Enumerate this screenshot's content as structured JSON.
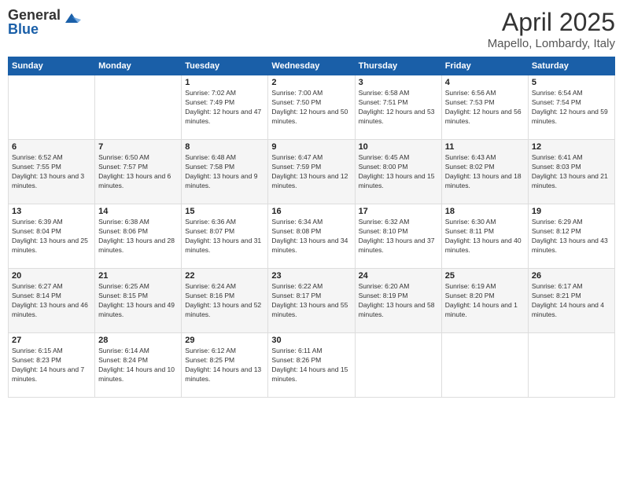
{
  "logo": {
    "general": "General",
    "blue": "Blue"
  },
  "header": {
    "month": "April 2025",
    "location": "Mapello, Lombardy, Italy"
  },
  "weekdays": [
    "Sunday",
    "Monday",
    "Tuesday",
    "Wednesday",
    "Thursday",
    "Friday",
    "Saturday"
  ],
  "weeks": [
    [
      {
        "day": "",
        "info": ""
      },
      {
        "day": "",
        "info": ""
      },
      {
        "day": "1",
        "info": "Sunrise: 7:02 AM\nSunset: 7:49 PM\nDaylight: 12 hours and 47 minutes."
      },
      {
        "day": "2",
        "info": "Sunrise: 7:00 AM\nSunset: 7:50 PM\nDaylight: 12 hours and 50 minutes."
      },
      {
        "day": "3",
        "info": "Sunrise: 6:58 AM\nSunset: 7:51 PM\nDaylight: 12 hours and 53 minutes."
      },
      {
        "day": "4",
        "info": "Sunrise: 6:56 AM\nSunset: 7:53 PM\nDaylight: 12 hours and 56 minutes."
      },
      {
        "day": "5",
        "info": "Sunrise: 6:54 AM\nSunset: 7:54 PM\nDaylight: 12 hours and 59 minutes."
      }
    ],
    [
      {
        "day": "6",
        "info": "Sunrise: 6:52 AM\nSunset: 7:55 PM\nDaylight: 13 hours and 3 minutes."
      },
      {
        "day": "7",
        "info": "Sunrise: 6:50 AM\nSunset: 7:57 PM\nDaylight: 13 hours and 6 minutes."
      },
      {
        "day": "8",
        "info": "Sunrise: 6:48 AM\nSunset: 7:58 PM\nDaylight: 13 hours and 9 minutes."
      },
      {
        "day": "9",
        "info": "Sunrise: 6:47 AM\nSunset: 7:59 PM\nDaylight: 13 hours and 12 minutes."
      },
      {
        "day": "10",
        "info": "Sunrise: 6:45 AM\nSunset: 8:00 PM\nDaylight: 13 hours and 15 minutes."
      },
      {
        "day": "11",
        "info": "Sunrise: 6:43 AM\nSunset: 8:02 PM\nDaylight: 13 hours and 18 minutes."
      },
      {
        "day": "12",
        "info": "Sunrise: 6:41 AM\nSunset: 8:03 PM\nDaylight: 13 hours and 21 minutes."
      }
    ],
    [
      {
        "day": "13",
        "info": "Sunrise: 6:39 AM\nSunset: 8:04 PM\nDaylight: 13 hours and 25 minutes."
      },
      {
        "day": "14",
        "info": "Sunrise: 6:38 AM\nSunset: 8:06 PM\nDaylight: 13 hours and 28 minutes."
      },
      {
        "day": "15",
        "info": "Sunrise: 6:36 AM\nSunset: 8:07 PM\nDaylight: 13 hours and 31 minutes."
      },
      {
        "day": "16",
        "info": "Sunrise: 6:34 AM\nSunset: 8:08 PM\nDaylight: 13 hours and 34 minutes."
      },
      {
        "day": "17",
        "info": "Sunrise: 6:32 AM\nSunset: 8:10 PM\nDaylight: 13 hours and 37 minutes."
      },
      {
        "day": "18",
        "info": "Sunrise: 6:30 AM\nSunset: 8:11 PM\nDaylight: 13 hours and 40 minutes."
      },
      {
        "day": "19",
        "info": "Sunrise: 6:29 AM\nSunset: 8:12 PM\nDaylight: 13 hours and 43 minutes."
      }
    ],
    [
      {
        "day": "20",
        "info": "Sunrise: 6:27 AM\nSunset: 8:14 PM\nDaylight: 13 hours and 46 minutes."
      },
      {
        "day": "21",
        "info": "Sunrise: 6:25 AM\nSunset: 8:15 PM\nDaylight: 13 hours and 49 minutes."
      },
      {
        "day": "22",
        "info": "Sunrise: 6:24 AM\nSunset: 8:16 PM\nDaylight: 13 hours and 52 minutes."
      },
      {
        "day": "23",
        "info": "Sunrise: 6:22 AM\nSunset: 8:17 PM\nDaylight: 13 hours and 55 minutes."
      },
      {
        "day": "24",
        "info": "Sunrise: 6:20 AM\nSunset: 8:19 PM\nDaylight: 13 hours and 58 minutes."
      },
      {
        "day": "25",
        "info": "Sunrise: 6:19 AM\nSunset: 8:20 PM\nDaylight: 14 hours and 1 minute."
      },
      {
        "day": "26",
        "info": "Sunrise: 6:17 AM\nSunset: 8:21 PM\nDaylight: 14 hours and 4 minutes."
      }
    ],
    [
      {
        "day": "27",
        "info": "Sunrise: 6:15 AM\nSunset: 8:23 PM\nDaylight: 14 hours and 7 minutes."
      },
      {
        "day": "28",
        "info": "Sunrise: 6:14 AM\nSunset: 8:24 PM\nDaylight: 14 hours and 10 minutes."
      },
      {
        "day": "29",
        "info": "Sunrise: 6:12 AM\nSunset: 8:25 PM\nDaylight: 14 hours and 13 minutes."
      },
      {
        "day": "30",
        "info": "Sunrise: 6:11 AM\nSunset: 8:26 PM\nDaylight: 14 hours and 15 minutes."
      },
      {
        "day": "",
        "info": ""
      },
      {
        "day": "",
        "info": ""
      },
      {
        "day": "",
        "info": ""
      }
    ]
  ]
}
